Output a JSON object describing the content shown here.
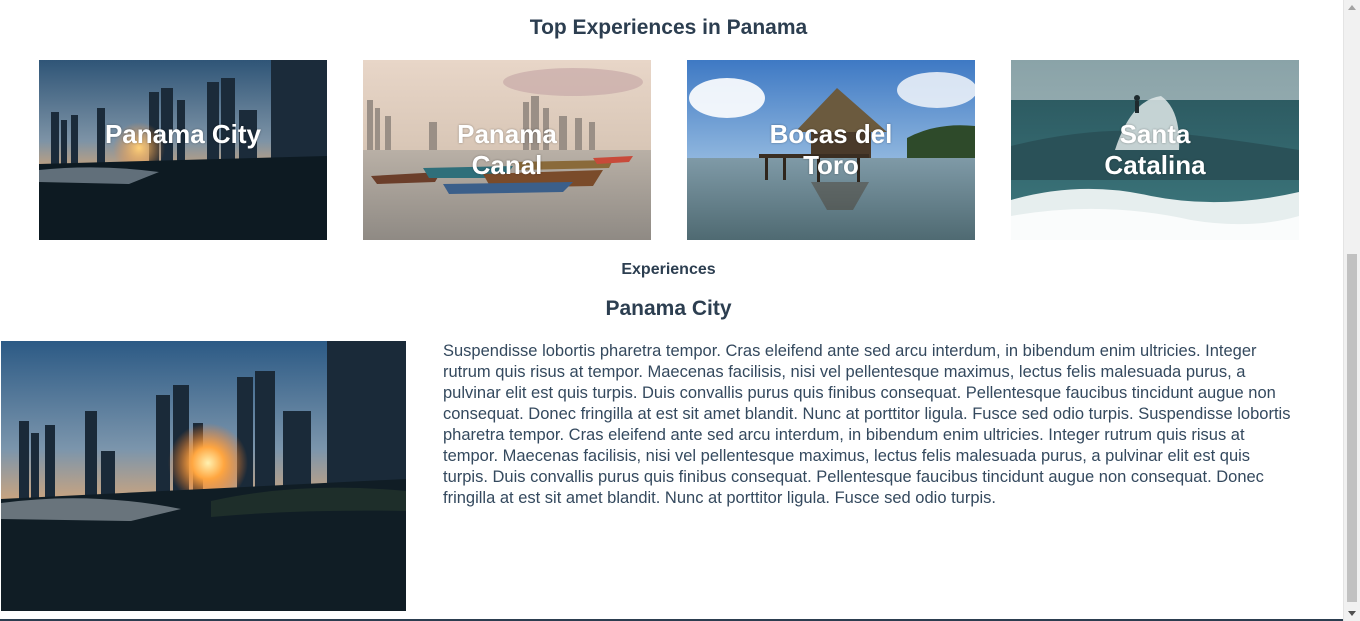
{
  "header": {
    "title": "Top Experiences in Panama"
  },
  "cards": [
    {
      "label": "Panama City",
      "icon": "panama-city-skyline-image"
    },
    {
      "label": "Panama Canal",
      "icon": "panama-canal-boats-image"
    },
    {
      "label": "Bocas del Toro",
      "icon": "bocas-del-toro-hut-image"
    },
    {
      "label": "Santa Catalina",
      "icon": "santa-catalina-surf-image"
    }
  ],
  "section": {
    "label": "Experiences"
  },
  "detail": {
    "title": "Panama City",
    "image": "panama-city-sunset-image",
    "text": "Suspendisse lobortis pharetra tempor. Cras eleifend ante sed arcu interdum, in bibendum enim ultricies. Integer rutrum quis risus at tempor. Maecenas facilisis, nisi vel pellentesque maximus, lectus felis malesuada purus, a pulvinar elit est quis turpis. Duis convallis purus quis finibus consequat. Pellentesque faucibus tincidunt augue non consequat. Donec fringilla at est sit amet blandit. Nunc at porttitor ligula. Fusce sed odio turpis. Suspendisse lobortis pharetra tempor. Cras eleifend ante sed arcu interdum, in bibendum enim ultricies. Integer rutrum quis risus at tempor. Maecenas facilisis, nisi vel pellentesque maximus, lectus felis malesuada purus, a pulvinar elit est quis turpis. Duis convallis purus quis finibus consequat. Pellentesque faucibus tincidunt augue non consequat. Donec fringilla at est sit amet blandit. Nunc at porttitor ligula. Fusce sed odio turpis."
  },
  "colors": {
    "text": "#2c3e50",
    "card_label": "#ffffff"
  }
}
